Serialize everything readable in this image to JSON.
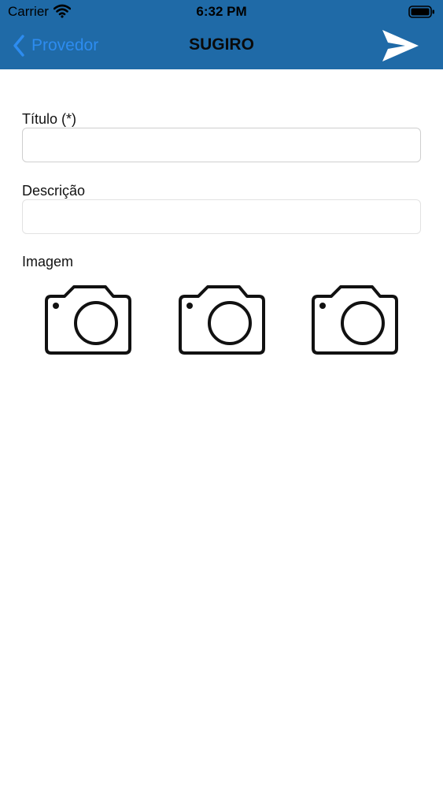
{
  "status_bar": {
    "carrier": "Carrier",
    "time": "6:32 PM"
  },
  "nav": {
    "back_label": "Provedor",
    "title": "SUGIRO",
    "send_icon": "send-icon"
  },
  "form": {
    "title_label": "Título (*)",
    "title_value": "",
    "description_label": "Descrição",
    "description_value": "",
    "image_label": "Imagem",
    "image_slots": [
      "camera-icon",
      "camera-icon",
      "camera-icon"
    ]
  },
  "colors": {
    "header_bg": "#1f6aa7",
    "back_link": "#2d8cf0"
  }
}
